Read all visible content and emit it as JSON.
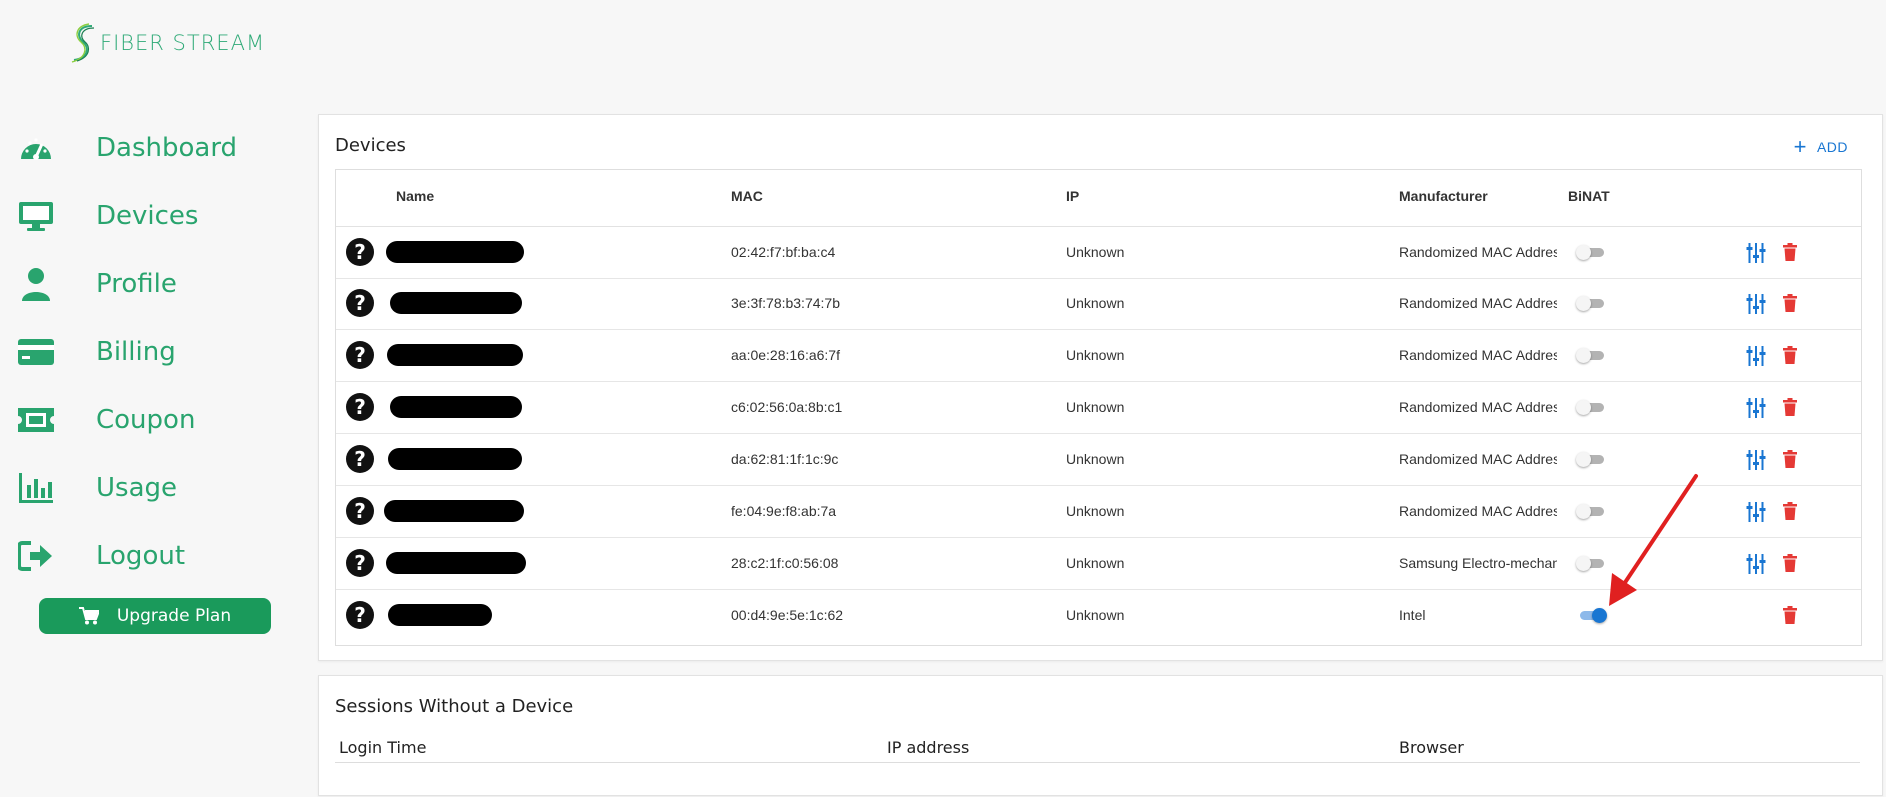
{
  "brand": {
    "name": "FIBER STREAM",
    "color": "#2faa77"
  },
  "sidebar": {
    "items": [
      {
        "label": "Dashboard",
        "icon": "speedometer-icon"
      },
      {
        "label": "Devices",
        "icon": "monitor-icon"
      },
      {
        "label": "Profile",
        "icon": "person-icon"
      },
      {
        "label": "Billing",
        "icon": "credit-card-icon"
      },
      {
        "label": "Coupon",
        "icon": "ticket-icon"
      },
      {
        "label": "Usage",
        "icon": "bar-chart-icon"
      },
      {
        "label": "Logout",
        "icon": "logout-icon"
      }
    ],
    "upgrade_label": "Upgrade Plan"
  },
  "devices": {
    "title": "Devices",
    "add_label": "ADD",
    "columns": {
      "name": "Name",
      "mac": "MAC",
      "ip": "IP",
      "manufacturer": "Manufacturer",
      "binat": "BiNAT"
    },
    "rows": [
      {
        "mac": "02:42:f7:bf:ba:c4",
        "ip": "Unknown",
        "manufacturer": "Randomized MAC Address",
        "binat": false,
        "has_settings": true
      },
      {
        "mac": "3e:3f:78:b3:74:7b",
        "ip": "Unknown",
        "manufacturer": "Randomized MAC Address",
        "binat": false,
        "has_settings": true
      },
      {
        "mac": "aa:0e:28:16:a6:7f",
        "ip": "Unknown",
        "manufacturer": "Randomized MAC Address",
        "binat": false,
        "has_settings": true
      },
      {
        "mac": "c6:02:56:0a:8b:c1",
        "ip": "Unknown",
        "manufacturer": "Randomized MAC Address",
        "binat": false,
        "has_settings": true
      },
      {
        "mac": "da:62:81:1f:1c:9c",
        "ip": "Unknown",
        "manufacturer": "Randomized MAC Address",
        "binat": false,
        "has_settings": true
      },
      {
        "mac": "fe:04:9e:f8:ab:7a",
        "ip": "Unknown",
        "manufacturer": "Randomized MAC Address",
        "binat": false,
        "has_settings": true
      },
      {
        "mac": "28:c2:1f:c0:56:08",
        "ip": "Unknown",
        "manufacturer": "Samsung Electro-mechanics",
        "binat": false,
        "has_settings": true
      },
      {
        "mac": "00:d4:9e:5e:1c:62",
        "ip": "Unknown",
        "manufacturer": "Intel",
        "binat": true,
        "has_settings": false
      }
    ]
  },
  "sessions": {
    "title": "Sessions Without a Device",
    "columns": {
      "login_time": "Login Time",
      "ip_address": "IP address",
      "browser": "Browser"
    }
  },
  "colors": {
    "accent": "#29a46e",
    "primary": "#1976d2",
    "danger": "#e53935",
    "arrow": "#e02020"
  }
}
